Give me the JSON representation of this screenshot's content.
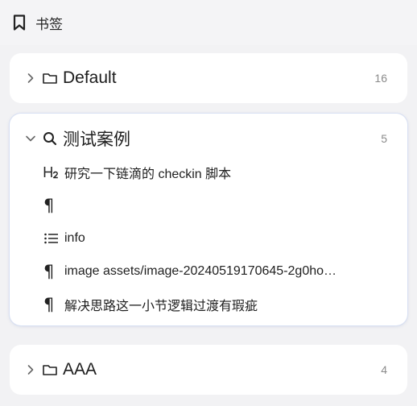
{
  "header": {
    "title": "书签",
    "icon": "bookmark-icon"
  },
  "groups": [
    {
      "label": "Default",
      "count": "16",
      "expanded": false,
      "icon": "folder-icon"
    },
    {
      "label": "测试案例",
      "count": "5",
      "expanded": true,
      "icon": "search-icon",
      "items": [
        {
          "icon": "heading-2-icon",
          "text": "研究一下链滴的 checkin 脚本"
        },
        {
          "icon": "paragraph-icon",
          "text": ""
        },
        {
          "icon": "list-icon",
          "text": "info"
        },
        {
          "icon": "paragraph-icon",
          "text": "image assets/image-20240519170645-2g0ho…"
        },
        {
          "icon": "paragraph-icon",
          "text": "解决思路这一小节逻辑过渡有瑕疵"
        }
      ]
    },
    {
      "label": "AAA",
      "count": "4",
      "expanded": false,
      "icon": "folder-icon"
    }
  ],
  "colors": {
    "accent_border": "#d7dff2",
    "background": "#f2f2f4",
    "card": "#ffffff",
    "count": "#8a8a8a"
  }
}
